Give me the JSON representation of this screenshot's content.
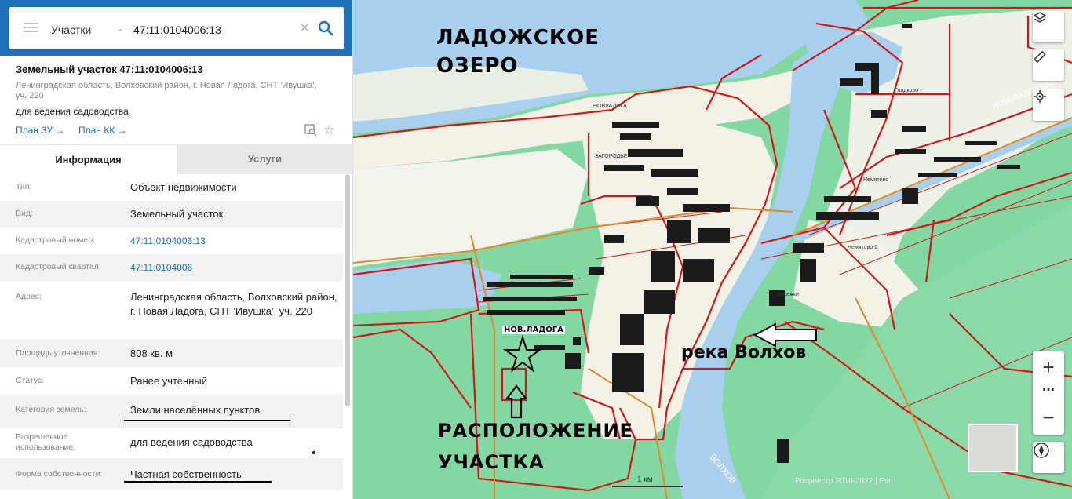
{
  "search": {
    "type_label": "Участки",
    "value": "47:11:0104006:13"
  },
  "object": {
    "title": "Земельный участок 47:11:0104006:13",
    "address": "Ленинградская область, Волховский район, г. Новая Ладога, СНТ 'Ивушка', уч. 220",
    "purpose": "для ведения садоводства",
    "plan_zu": "План ЗУ →",
    "plan_kk": "План КК →"
  },
  "tabs": {
    "info": "Информация",
    "services": "Услуги"
  },
  "properties": [
    {
      "label": "Тип:",
      "value": "Объект недвижимости"
    },
    {
      "label": "Вид:",
      "value": "Земельный участок"
    },
    {
      "label": "Кадастровый номер:",
      "value": "47:11:0104006:13"
    },
    {
      "label": "Кадастровый квартал:",
      "value": "47:11:0104006"
    },
    {
      "label": "Адрес:",
      "value": "Ленинградская область, Волховский район, г. Новая Ладога, СНТ 'Ивушка', уч. 220"
    },
    {
      "label": "Площадь уточненная:",
      "value": "808 кв. м"
    },
    {
      "label": "Статус:",
      "value": "Ранее учтенный"
    },
    {
      "label": "Категория земель:",
      "value": "Земли населённых пунктов"
    },
    {
      "label": "Разрешенное использование:",
      "value": "для ведения садоводства"
    },
    {
      "label": "Форма собственности:",
      "value": "Частная собственность"
    }
  ],
  "map": {
    "lake_label_1": "ЛАДОЖСКОЕ",
    "lake_label_2": "ОЗЕРО",
    "river_label": "река Волхов",
    "site_label_1": "РАСПОЛОЖЕНИЕ",
    "site_label_2": "УЧАСТКА",
    "town_label": "НОВ.ЛАДОГА",
    "village_labels": [
      "Немятово-2",
      "Немятово",
      "Гладково",
      "Бережки",
      "НОВЛАДОГА",
      "ЗАГОРОДЬЕ"
    ],
    "river_map_text": "ВОЛХОВ",
    "canal_text": "НОВОЛАДОЖСКИ",
    "scale": "1 км",
    "copyright": "Росреестр 2010-2022 | Esri"
  },
  "colors": {
    "header_blue": "#1e70b8",
    "water": "#a9cfee",
    "forest": "#7fd9a0",
    "boundary_red": "#d01818"
  }
}
